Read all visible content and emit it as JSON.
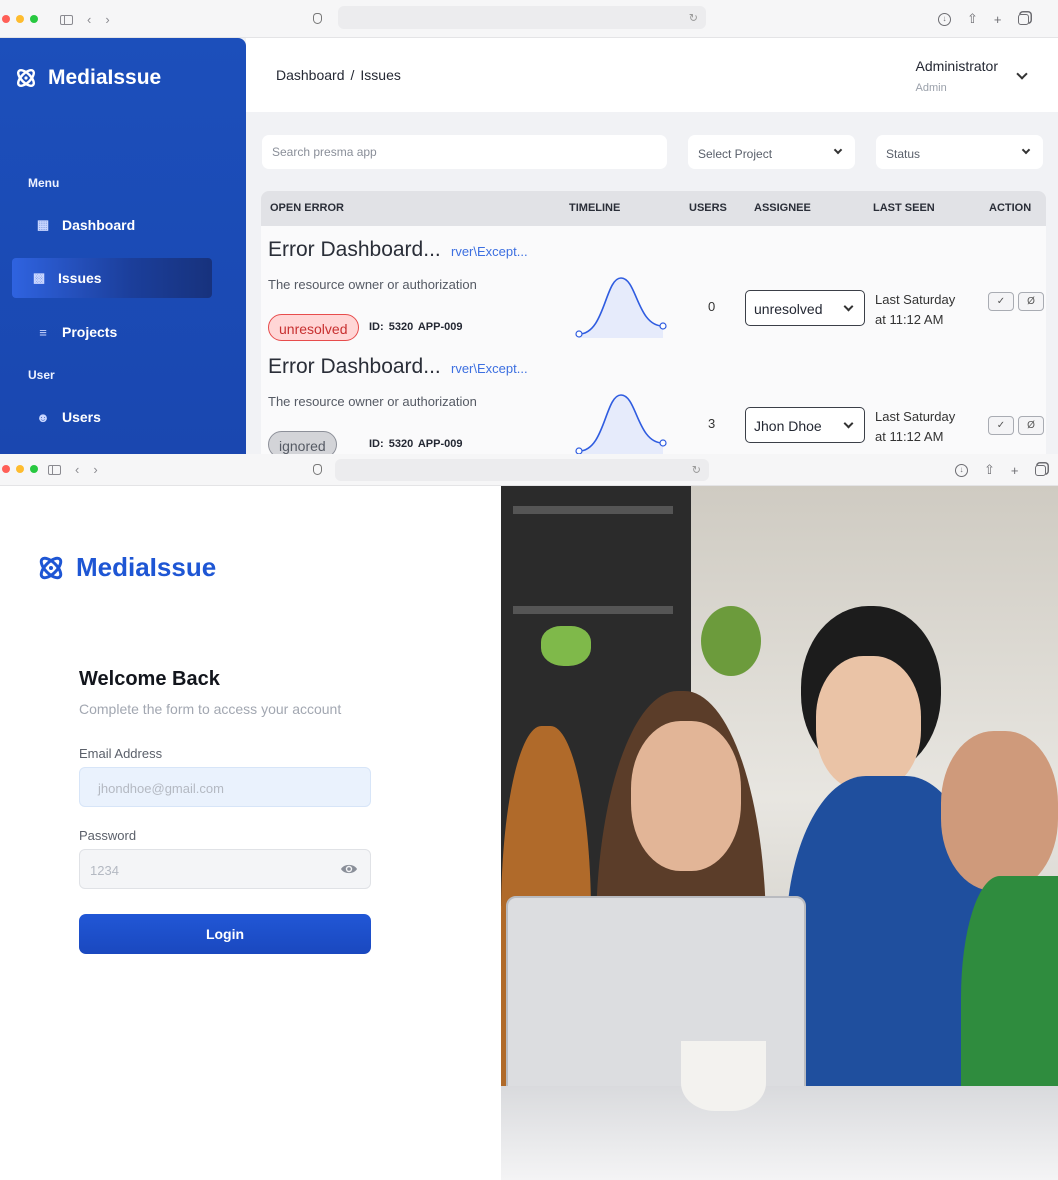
{
  "dashboard": {
    "brand": "MediaIssue",
    "sidebar": {
      "menu_heading": "Menu",
      "user_heading": "User",
      "items": [
        {
          "label": "Dashboard",
          "icon": "grid-icon"
        },
        {
          "label": "Issues",
          "icon": "bar-chart-icon"
        },
        {
          "label": "Projects",
          "icon": "sliders-icon"
        },
        {
          "label": "Users",
          "icon": "user-list-icon"
        }
      ]
    },
    "breadcrumb": {
      "root": "Dashboard",
      "separator": "/",
      "current": "Issues"
    },
    "user": {
      "name": "Administrator",
      "role": "Admin"
    },
    "search_placeholder": "Search presma app",
    "filters": {
      "project": "Select Project",
      "status": "Status"
    },
    "table": {
      "columns": [
        "OPEN ERROR",
        "TIMELINE",
        "USERS",
        "ASSIGNEE",
        "LAST SEEN",
        "ACTION"
      ],
      "rows": [
        {
          "title": "Error Dashboard...",
          "exception": "rver\\Except...",
          "description": "The resource owner or authorization",
          "status": "unresolved",
          "meta": "ID: 5320  APP-009",
          "users": "0",
          "assignee": "unresolved",
          "last_seen_line1": "Last Saturday",
          "last_seen_line2": "at 11:12 AM"
        },
        {
          "title": "Error Dashboard...",
          "exception": "rver\\Except...",
          "description": "The resource owner or authorization",
          "status": "ignored",
          "meta": "ID: 5320  APP-009",
          "users": "3",
          "assignee": "Jhon Dhoe",
          "last_seen_line1": "Last Saturday",
          "last_seen_line2": "at 11:12 AM"
        }
      ]
    },
    "colors": {
      "sidebar": "#1c4fbb",
      "accent": "#1e56d4",
      "link": "#3c6fe0",
      "danger": "#e74c4c"
    }
  },
  "login": {
    "brand": "MediaIssue",
    "title": "Welcome Back",
    "subtitle": "Complete the form to access your account",
    "email_label": "Email Address",
    "email_placeholder": "jhondhoe@gmail.com",
    "password_label": "Password",
    "password_placeholder": "1234",
    "login_button": "Login"
  }
}
